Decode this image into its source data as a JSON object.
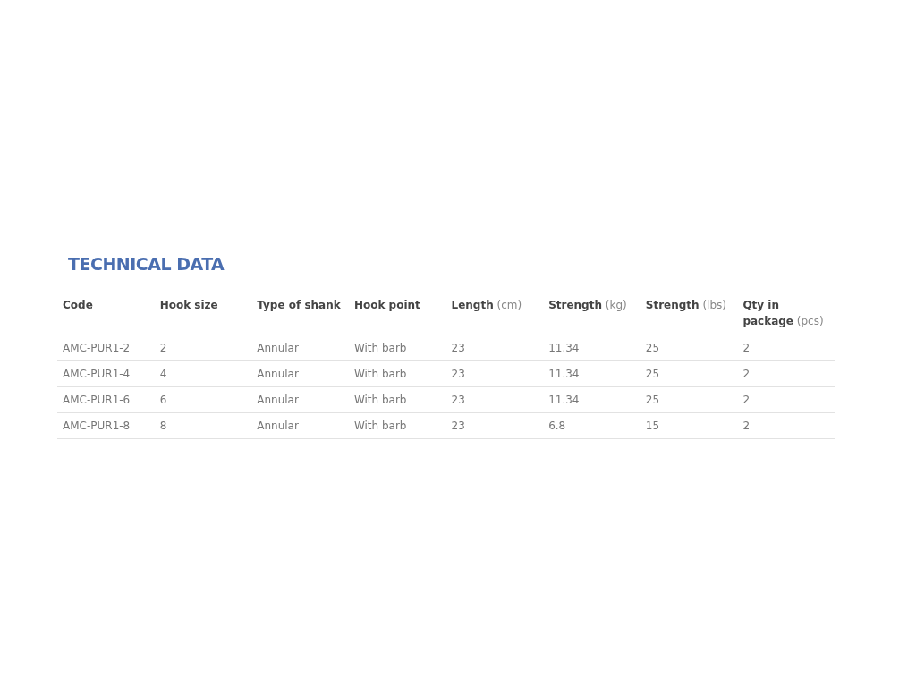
{
  "title": "TECHNICAL DATA",
  "table": {
    "columns": [
      "**Code**",
      "**Hook size**",
      "**Type of shank**",
      "**Hook point**",
      "**Length** (cm)",
      "**Strength** (kg)",
      "**Strength** (lbs)",
      "**Qty in package** (pcs)"
    ],
    "rows": [
      [
        "AMC-PUR1-2",
        "2",
        "Annular",
        "With barb",
        "23",
        "11.34",
        "25",
        "2"
      ],
      [
        "AMC-PUR1-4",
        "4",
        "Annular",
        "With barb",
        "23",
        "11.34",
        "25",
        "2"
      ],
      [
        "AMC-PUR1-6",
        "6",
        "Annular",
        "With barb",
        "23",
        "11.34",
        "25",
        "2"
      ],
      [
        "AMC-PUR1-8",
        "8",
        "Annular",
        "With barb",
        "23",
        "6.8",
        "15",
        "2"
      ]
    ]
  }
}
